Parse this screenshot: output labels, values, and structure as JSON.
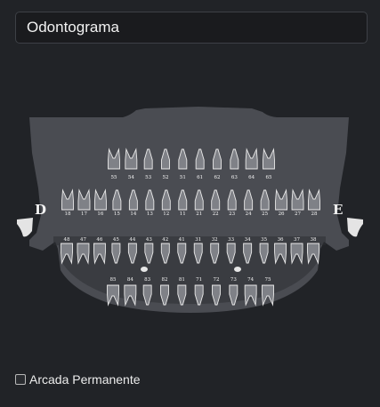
{
  "header": {
    "title": "Odontograma"
  },
  "labels": {
    "right_side": "D",
    "left_side": "E"
  },
  "upper_primary": [
    "55",
    "54",
    "53",
    "52",
    "51",
    "61",
    "62",
    "63",
    "64",
    "65"
  ],
  "upper_permanent": [
    "18",
    "17",
    "16",
    "15",
    "14",
    "13",
    "12",
    "11",
    "21",
    "22",
    "23",
    "24",
    "25",
    "26",
    "27",
    "28"
  ],
  "lower_permanent": [
    "48",
    "47",
    "46",
    "45",
    "44",
    "43",
    "42",
    "41",
    "31",
    "32",
    "33",
    "34",
    "35",
    "36",
    "37",
    "38"
  ],
  "lower_primary": [
    "85",
    "84",
    "83",
    "82",
    "81",
    "71",
    "72",
    "73",
    "74",
    "75"
  ],
  "footer": {
    "permanent_label": "Arcada Permanente",
    "permanent_checked": false
  },
  "colors": {
    "background": "#212327",
    "skull": "#4a4c52",
    "tooth": "#7f8187",
    "tooth_outline": "#e9e9e9",
    "number": "#f5f5f5"
  }
}
